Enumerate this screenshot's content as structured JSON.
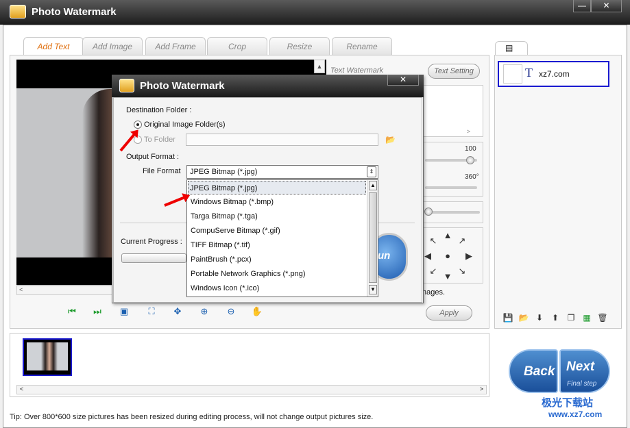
{
  "window": {
    "title": "Photo Watermark",
    "minimize_label": "—",
    "close_label": "✕"
  },
  "tabs": [
    {
      "label": "Add Text"
    },
    {
      "label": "Add Image"
    },
    {
      "label": "Add Frame"
    },
    {
      "label": "Crop"
    },
    {
      "label": "Resize"
    },
    {
      "label": "Rename"
    }
  ],
  "settings": {
    "section_label": "Text Watermark",
    "text_setting_button": "Text Setting",
    "opacity_max": "100",
    "rotate_max": "360°",
    "images_suffix": "nages.",
    "apply_button": "Apply"
  },
  "layer_list": {
    "items": [
      {
        "type_icon": "T",
        "label": "xz7.com"
      }
    ]
  },
  "nav": {
    "back_label": "Back",
    "next_label": "Next",
    "next_sub": "Final step"
  },
  "status": {
    "tip": "Tip: Over 800*600 size pictures has been resized during editing process, will not change output pictures size."
  },
  "dialog": {
    "title": "Photo Watermark",
    "close_label": "✕",
    "destination_label": "Destination Folder :",
    "original_folder_label": "Original Image Folder(s)",
    "to_folder_label": "To Folder",
    "to_folder_value": "",
    "output_format_label": "Output Format :",
    "file_format_label": "File Format",
    "file_format_value": "JPEG Bitmap (*.jpg)",
    "file_format_options": [
      "JPEG Bitmap (*.jpg)",
      "Windows Bitmap (*.bmp)",
      "Targa Bitmap (*.tga)",
      "CompuServe Bitmap (*.gif)",
      "TIFF Bitmap (*.tif)",
      "PaintBrush (*.pcx)",
      "Portable Network Graphics (*.png)",
      "Windows Icon (*.ico)"
    ],
    "progress_label": "Current Progress :",
    "run_label": "un"
  },
  "watermark": {
    "site": "极光下载站",
    "url": "www.xz7.com"
  }
}
